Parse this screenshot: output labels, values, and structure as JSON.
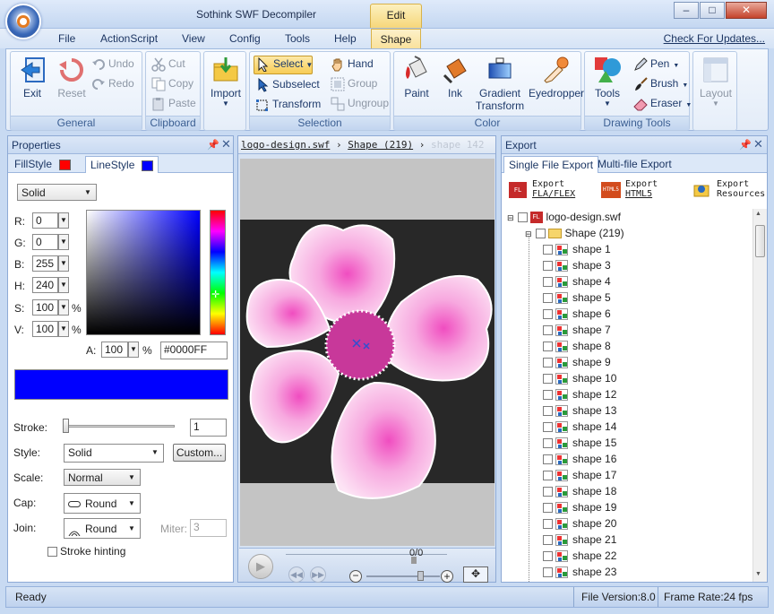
{
  "app": {
    "title": "Sothink SWF Decompiler",
    "context_tab": "Edit"
  },
  "window_buttons": {
    "minimize": "–",
    "maximize": "□",
    "close": "✕"
  },
  "menu": {
    "items": [
      "File",
      "ActionScript",
      "View",
      "Config",
      "Tools",
      "Help"
    ],
    "active": "Shape",
    "check_updates": "Check For Updates..."
  },
  "ribbon": {
    "general": {
      "label": "General",
      "exit": "Exit",
      "reset": "Reset",
      "undo": "Undo",
      "redo": "Redo"
    },
    "clipboard": {
      "label": "Clipboard",
      "cut": "Cut",
      "copy": "Copy",
      "paste": "Paste",
      "import": "Import"
    },
    "selection": {
      "label": "Selection",
      "select": "Select",
      "subselect": "Subselect",
      "transform": "Transform",
      "hand": "Hand",
      "group": "Group",
      "ungroup": "Ungroup"
    },
    "color": {
      "label": "Color",
      "paint": "Paint",
      "ink": "Ink",
      "gradient_line1": "Gradient",
      "gradient_line2": "Transform",
      "eyedropper": "Eyedropper"
    },
    "drawing": {
      "label": "Drawing Tools",
      "tools": "Tools",
      "pen": "Pen",
      "brush": "Brush",
      "eraser": "Eraser",
      "layout": "Layout"
    }
  },
  "properties": {
    "title": "Properties",
    "tabs": {
      "fill": "FillStyle",
      "line": "LineStyle",
      "fill_color": "#ff0000",
      "line_color": "#0000ff"
    },
    "fill_type": "Solid",
    "channels": {
      "r_label": "R:",
      "r": "0",
      "g_label": "G:",
      "g": "0",
      "b_label": "B:",
      "b": "255",
      "h_label": "H:",
      "h": "240",
      "s_label": "S:",
      "s": "100",
      "v_label": "V:",
      "v": "100",
      "pct": "%"
    },
    "alpha_label": "A:",
    "alpha": "100",
    "alpha_pct": "%",
    "hex": "#0000FF",
    "current_color": "#0000ff",
    "stroke_label": "Stroke:",
    "stroke_value": "1",
    "style_label": "Style:",
    "style_value": "Solid",
    "custom_btn": "Custom...",
    "scale_label": "Scale:",
    "scale_value": "Normal",
    "cap_label": "Cap:",
    "cap_value": "Round",
    "join_label": "Join:",
    "join_value": "Round",
    "miter_label": "Miter:",
    "miter_value": "3",
    "hinting_label": "Stroke hinting"
  },
  "stage": {
    "breadcrumb": [
      "logo-design.swf",
      "Shape (219)",
      "shape 142"
    ],
    "frame_counter": "0/0"
  },
  "export": {
    "title": "Export",
    "tabs": [
      "Single File Export",
      "Multi-file Export"
    ],
    "buttons": [
      {
        "icon": "FL FX",
        "line1": "Export",
        "line2": "FLA/FLEX"
      },
      {
        "icon": "HTML5",
        "line1": "Export",
        "line2": "HTML5"
      },
      {
        "icon": "",
        "line1": "Export",
        "line2": "Resources"
      }
    ],
    "root": "logo-design.swf",
    "folder": "Shape (219)",
    "items": [
      "shape 1",
      "shape 3",
      "shape 4",
      "shape 5",
      "shape 6",
      "shape 7",
      "shape 8",
      "shape 9",
      "shape 10",
      "shape 12",
      "shape 13",
      "shape 14",
      "shape 15",
      "shape 16",
      "shape 17",
      "shape 18",
      "shape 19",
      "shape 20",
      "shape 21",
      "shape 22",
      "shape 23"
    ]
  },
  "status": {
    "ready": "Ready",
    "file_version": "File Version:8.0",
    "frame_rate": "Frame Rate:24 fps"
  }
}
